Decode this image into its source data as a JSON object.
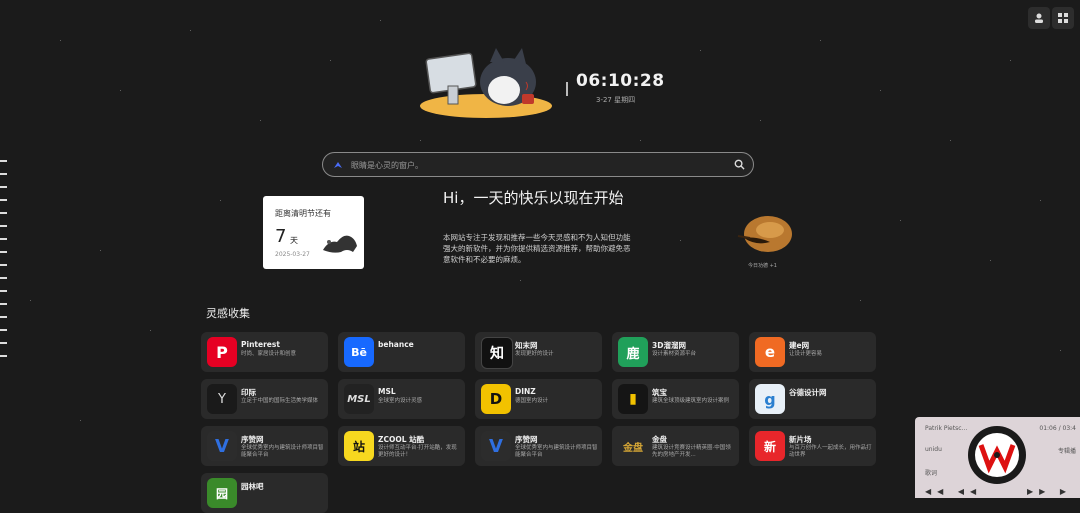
{
  "header": {
    "time": "06:10:28",
    "date": "3-27 星期四"
  },
  "search": {
    "placeholder": "眼睛是心灵的窗户。"
  },
  "countdown": {
    "title": "距离清明节还有",
    "days": "7",
    "unit": "天",
    "date": "2025-03-27"
  },
  "greeting": {
    "title": "Hi，一天的快乐以现在开始",
    "description": "本网站专注于发现和推荐一些今天灵感和不为人知但功能强大的新软件，并为你提供精选资源推荐，帮助你避免恶意软件和不必要的麻烦。"
  },
  "bird": {
    "caption": "今日功德 +1"
  },
  "section": {
    "title": "灵感收集",
    "items": [
      {
        "name": "Pinterest",
        "desc": "时尚、家居设计和创意",
        "icon": "pinterest-icon",
        "color": "#e60023",
        "glyph": "P"
      },
      {
        "name": "behance",
        "desc": "",
        "icon": "behance-icon",
        "color": "#1769ff",
        "glyph": "Bē"
      },
      {
        "name": "知末网",
        "desc": "发现更好的设计",
        "icon": "zhimo-icon",
        "color": "#111111",
        "glyph": "知"
      },
      {
        "name": "3D溜溜网",
        "desc": "设计素材资源平台",
        "icon": "3d66-icon",
        "color": "#20a05a",
        "glyph": "鹿"
      },
      {
        "name": "建e网",
        "desc": "让设计更容易",
        "icon": "jianew-icon",
        "color": "#f06a23",
        "glyph": "e"
      },
      {
        "name": "印际",
        "desc": "立足于中国的国际生活美学媒体",
        "icon": "yinji-icon",
        "color": "#1a1a1a",
        "glyph": "Y"
      },
      {
        "name": "MSL",
        "desc": "全球室内设计灵感",
        "icon": "msl-icon",
        "color": "#222222",
        "glyph": "MSL"
      },
      {
        "name": "DINZ",
        "desc": "德国室内设计",
        "icon": "dinz-icon",
        "color": "#f2c200",
        "glyph": "D"
      },
      {
        "name": "筑宝",
        "desc": "建筑全球顶级建筑室内设计案例",
        "icon": "zhubao-icon",
        "color": "#151515",
        "glyph": "▮"
      },
      {
        "name": "谷德设计网",
        "desc": "",
        "icon": "gooood-icon",
        "color": "#e8f0f8",
        "glyph": "g"
      },
      {
        "name": "序赞网",
        "desc": "全球优秀室内与建筑设计师项目智能聚合平台",
        "icon": "xuzan-icon",
        "color": "#2c2c2c",
        "glyph": "V"
      },
      {
        "name": "ZCOOL 站酷",
        "desc": "设计师互动平台·打开站酷，发现更好的设计！",
        "icon": "zcool-icon",
        "color": "#f7d81f",
        "glyph": "站"
      },
      {
        "name": "序赞网",
        "desc": "全球优秀室内与建筑设计师项目智能聚合平台",
        "icon": "xuzan-icon",
        "color": "#2c2c2c",
        "glyph": "V"
      },
      {
        "name": "金盘",
        "desc": "建筑设计竞赛设计精英圈·中国领先的房地产开发...",
        "icon": "jinpan-icon",
        "color": "#2a2a2a",
        "glyph": "金盘"
      },
      {
        "name": "新片场",
        "desc": "与百万创作人一起成长，用作品打动世界",
        "icon": "xinpianchang-icon",
        "color": "#e8262b",
        "glyph": "新"
      },
      {
        "name": "园林吧",
        "desc": "",
        "icon": "yuanlinba-icon",
        "color": "#3a8a2a",
        "glyph": "园"
      }
    ]
  },
  "player": {
    "song": "Patrik Pietsc...",
    "time": "01:06 / 03:4",
    "artist": "unidu",
    "list": "专辑播",
    "misc": "歌词",
    "controls_left": "◀◀ ◀◀",
    "controls_right": "▶▶ ▶"
  }
}
